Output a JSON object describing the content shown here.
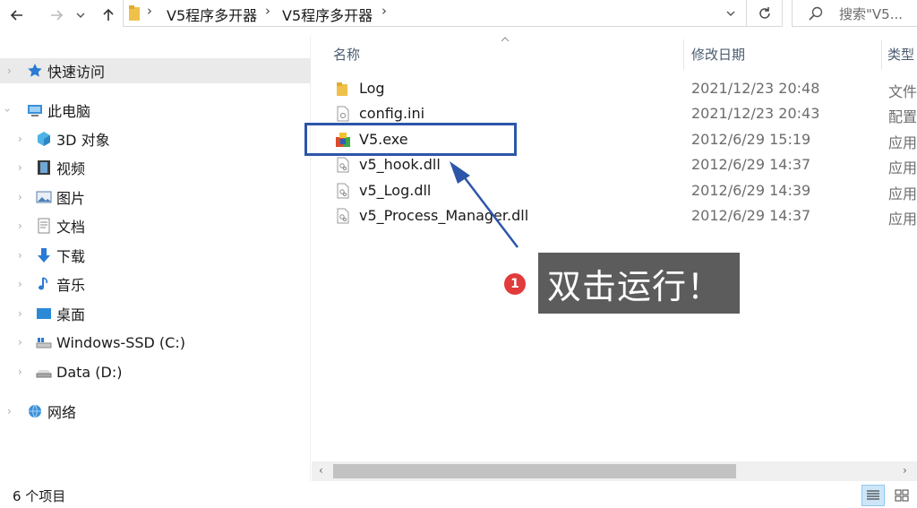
{
  "address": {
    "crumbs": [
      "V5程序多开器",
      "V5程序多开器"
    ],
    "search_placeholder": "搜索\"V5..."
  },
  "nav": {
    "quick_access": "快速访问",
    "this_pc": "此电脑",
    "items": [
      "3D 对象",
      "视频",
      "图片",
      "文档",
      "下载",
      "音乐",
      "桌面",
      "Windows-SSD (C:)",
      "Data (D:)"
    ],
    "network": "网络"
  },
  "columns": {
    "name": "名称",
    "date": "修改日期",
    "type": "类型"
  },
  "files": [
    {
      "name": "Log",
      "date": "2021/12/23 20:48",
      "type": "文件",
      "icon": "folder-icon"
    },
    {
      "name": "config.ini",
      "date": "2021/12/23 20:43",
      "type": "配置",
      "icon": "ini-file-icon"
    },
    {
      "name": "V5.exe",
      "date": "2012/6/29 15:19",
      "type": "应用",
      "icon": "exe-app-icon"
    },
    {
      "name": "v5_hook.dll",
      "date": "2012/6/29 14:37",
      "type": "应用",
      "icon": "dll-file-icon"
    },
    {
      "name": "v5_Log.dll",
      "date": "2012/6/29 14:39",
      "type": "应用",
      "icon": "dll-file-icon"
    },
    {
      "name": "v5_Process_Manager.dll",
      "date": "2012/6/29 14:37",
      "type": "应用",
      "icon": "dll-file-icon"
    }
  ],
  "annotation": {
    "step": "1",
    "text": "双击运行！"
  },
  "status": {
    "count": "6 个项目"
  },
  "colors": {
    "highlight": "#2d56a8",
    "badge": "#e23b3b",
    "callout_bg": "#5c5c5c",
    "folder": "#f0c14a"
  }
}
